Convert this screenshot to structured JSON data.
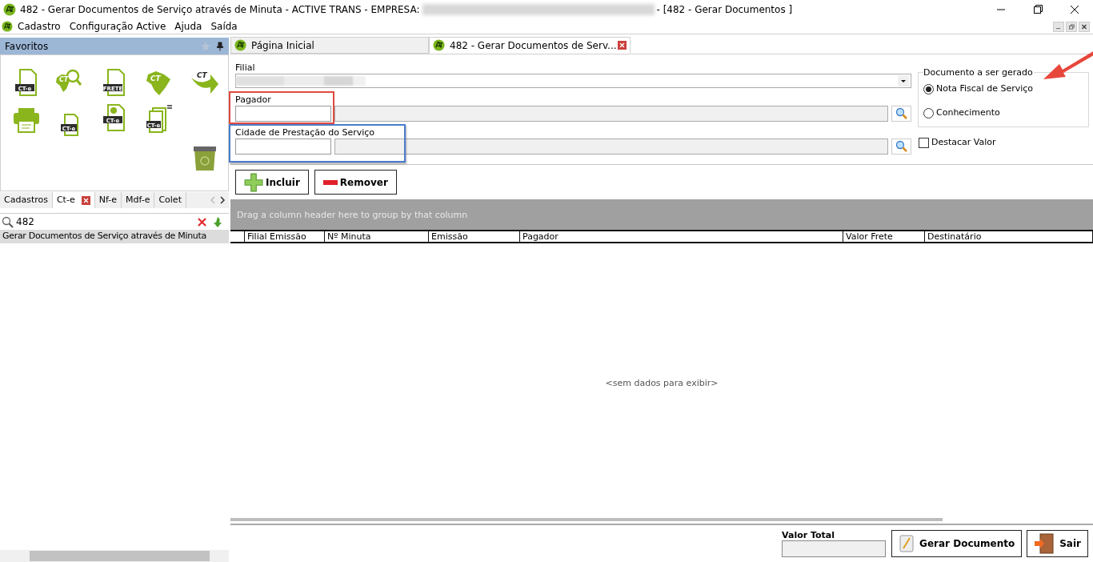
{
  "window": {
    "title_start": "482 - Gerar Documentos de Serviço através de Minuta - ACTIVE TRANS - EMPRESA:",
    "title_end": "- [482 - Gerar Documentos ]"
  },
  "menu": [
    "Cadastro",
    "Configuração Active",
    "Ajuda",
    "Saída"
  ],
  "sidebar": {
    "title": "Favoritos",
    "favorites": [
      {
        "kind": "doc",
        "badge": "CT-e"
      },
      {
        "kind": "map-search",
        "badge": "CT"
      },
      {
        "kind": "doc",
        "badge": "FRETE"
      },
      {
        "kind": "map",
        "badge": "CT"
      },
      {
        "kind": "arrow",
        "badge": "CT"
      },
      {
        "kind": "printer"
      },
      {
        "kind": "small-doc",
        "badge": "CT-e"
      },
      {
        "kind": "gear-doc",
        "badge": "CT-e"
      },
      {
        "kind": "stack",
        "badge": "CT-e"
      },
      {
        "kind": "trash"
      }
    ],
    "tabs": [
      {
        "label": "Cadastros",
        "selected": false
      },
      {
        "label": "Ct-e",
        "selected": true,
        "closable": true
      },
      {
        "label": "Nf-e",
        "selected": false
      },
      {
        "label": "Mdf-e",
        "selected": false
      },
      {
        "label": "Colet",
        "selected": false
      }
    ],
    "search": {
      "value": "482"
    },
    "results": [
      {
        "label": "Gerar Documentos de Serviço através de Minuta",
        "selected": true
      }
    ]
  },
  "tabs": [
    {
      "label": "Página Inicial",
      "selected": false,
      "closable": false
    },
    {
      "label": "482 - Gerar Documentos de Serv...",
      "selected": true,
      "closable": true
    }
  ],
  "form": {
    "filial_label": "Filial",
    "pagador": {
      "label": "Pagador",
      "color": "#e04a3f"
    },
    "cidade": {
      "label": "Cidade de Prestação do Serviço",
      "color": "#4a7ccc"
    },
    "document_group": {
      "title": "Documento a ser gerado",
      "options": [
        {
          "label": "Nota Fiscal de Serviço",
          "selected": true
        },
        {
          "label": "Conhecimento",
          "selected": false
        }
      ]
    },
    "destacar": {
      "label": "Destacar Valor",
      "checked": false
    },
    "pointer_arrow": {
      "color": "#e8473c"
    }
  },
  "buttons": [
    {
      "kind": "add",
      "label": "Incluir"
    },
    {
      "kind": "remove",
      "label": "Remover"
    }
  ],
  "grid": {
    "group_hint": "Drag a column header here to group by that column",
    "columns": [
      "Filial Emissão",
      "Nº Minuta",
      "Emissão",
      "Pagador",
      "Valor Frete",
      "Destinatário"
    ],
    "empty_text": "<sem dados para exibir>"
  },
  "footer": {
    "total_label": "Valor Total",
    "buttons": [
      {
        "kind": "generate",
        "label": "Gerar Documento"
      },
      {
        "kind": "exit",
        "label": "Sair"
      }
    ]
  }
}
